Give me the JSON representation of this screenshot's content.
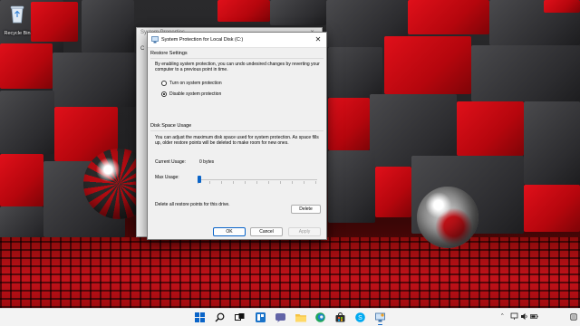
{
  "desktop": {
    "recycle_bin_label": "Recycle Bin"
  },
  "background_window": {
    "title": "System Properties",
    "visible_fragment": "C"
  },
  "dialog": {
    "title": "System Protection for Local Disk (C:)",
    "restore_settings": {
      "label": "Restore Settings",
      "description": "By enabling system protection, you can undo undesired changes by reverting your computer to a previous point in time.",
      "options": [
        {
          "label": "Turn on system protection",
          "selected": false
        },
        {
          "label": "Disable system protection",
          "selected": true
        }
      ]
    },
    "disk_space": {
      "label": "Disk Space Usage",
      "description": "You can adjust the maximum disk space used for system protection. As space fills up, older restore points will be deleted to make room for new ones.",
      "current_usage_label": "Current Usage:",
      "current_usage_value": "0 bytes",
      "max_usage_label": "Max Usage:",
      "max_usage_fraction": 0.0
    },
    "delete_text": "Delete all restore points for this drive.",
    "delete_button": "Delete",
    "ok_button": "OK",
    "cancel_button": "Cancel",
    "apply_button": "Apply"
  },
  "taskbar": {
    "icons": [
      "start-icon",
      "search-icon",
      "task-view-icon",
      "widgets-icon",
      "chat-icon",
      "file-explorer-icon",
      "edge-icon",
      "store-icon",
      "skype-icon",
      "control-panel-icon"
    ],
    "tray": {
      "chevron": "^",
      "clock_time": "",
      "clock_date": ""
    }
  },
  "colors": {
    "accent": "#0a64c8",
    "wallpaper_red": "#d10a14",
    "wallpaper_dark": "#2c2c2f"
  }
}
